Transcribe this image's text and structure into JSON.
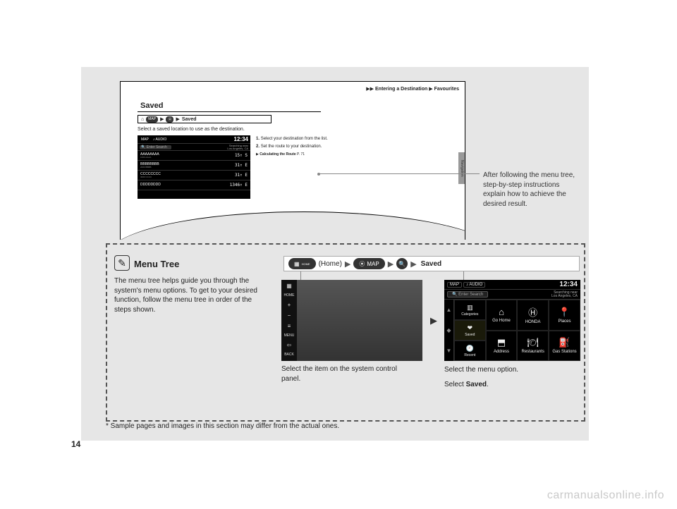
{
  "page_number": "14",
  "watermark": "carmanualsonline.info",
  "example": {
    "crumb_prefix": "▶▶",
    "crumb_a": "Entering a Destination",
    "crumb_sep": "▶",
    "crumb_b": "Favourites",
    "heading": "Saved",
    "bar_home_icon": "⌂",
    "bar_map_label": "MAP",
    "bar_mag_icon": "⦿",
    "bar_sep": "▶",
    "bar_last": "Saved",
    "desc": "Select a saved location to use as the destination.",
    "screen": {
      "tab_map": "MAP",
      "tab_audio": "♪ AUDIO",
      "time": "12:34",
      "search_placeholder": "🔍 Enter Search",
      "near_label": "Searching near",
      "near_value": "Los Angeles, CA",
      "rows": [
        {
          "name": "AAAAAAAA",
          "sub": "1000 AAAA",
          "dist": "15↑  S"
        },
        {
          "name": "BBBBBBBB",
          "sub": "2000 BBBB",
          "dist": "31↑  E"
        },
        {
          "name": "CCCCCCCC",
          "sub": "3000 CCCC",
          "dist": "31↑  E"
        },
        {
          "name": "DDDDDDDD",
          "sub": "",
          "dist": "1346↑  E"
        }
      ]
    },
    "step1_num": "1.",
    "step1": "Select your destination from the list.",
    "step2_num": "2.",
    "step2": "Set the route to your destination.",
    "ref_icon": "▶",
    "ref_label": "Calculating the Route",
    "ref_page": "P. 71",
    "side_tab": "Navigation"
  },
  "callout": "After following the menu tree, step-by-step instructions explain how to achieve the desired result.",
  "menutree": {
    "icon": "✎",
    "title": "Menu Tree",
    "para": "The menu tree helps guide you through the system's menu options. To get to your desired function, follow the menu tree in order of the steps shown.",
    "bc_home_icon": "▦",
    "bc_home_sub": "HOME",
    "bc_home_label": "(Home)",
    "bc_arrow": "▶",
    "bc_map_icon": "⦿",
    "bc_map_label": "MAP",
    "bc_mag_icon": "🔍",
    "bc_saved": "Saved",
    "panel": {
      "icons": [
        {
          "ic": "▦",
          "lbl": "HOME"
        },
        {
          "ic": "+",
          "lbl": ""
        },
        {
          "ic": "−",
          "lbl": ""
        },
        {
          "ic": "≡",
          "lbl": "MENU"
        },
        {
          "ic": "⇦",
          "lbl": "BACK"
        }
      ]
    },
    "panel_caption": "Select the item on the system control panel.",
    "mid_arrow": "▶",
    "nav": {
      "tab_map": "MAP",
      "tab_audio": "♪ AUDIO",
      "time": "12:34",
      "search_placeholder": "🔍 Enter Search",
      "near_label": "Searching near",
      "near_value": "Los Angeles, CA",
      "cells": [
        {
          "ic": "⌂",
          "lbl": "Go Home"
        },
        {
          "ic": "Ⓗ",
          "lbl": "HONDA"
        },
        {
          "ic": "📍",
          "lbl": "Places"
        },
        {
          "ic": "⬒",
          "lbl": "Address"
        },
        {
          "ic": "🍽",
          "lbl": "Restaurants"
        },
        {
          "ic": "⛽",
          "lbl": "Gas Stations"
        }
      ],
      "rcells": [
        {
          "ic": "▥",
          "lbl": "Categories"
        },
        {
          "ic": "❤",
          "lbl": "Saved"
        },
        {
          "ic": "🕘",
          "lbl": "Recent"
        }
      ]
    },
    "nav_caption_1": "Select the menu option.",
    "nav_caption_2a": "Select ",
    "nav_caption_2b": "Saved",
    "nav_caption_2c": "."
  },
  "footnote": "* Sample pages and images in this section may differ from the actual ones."
}
